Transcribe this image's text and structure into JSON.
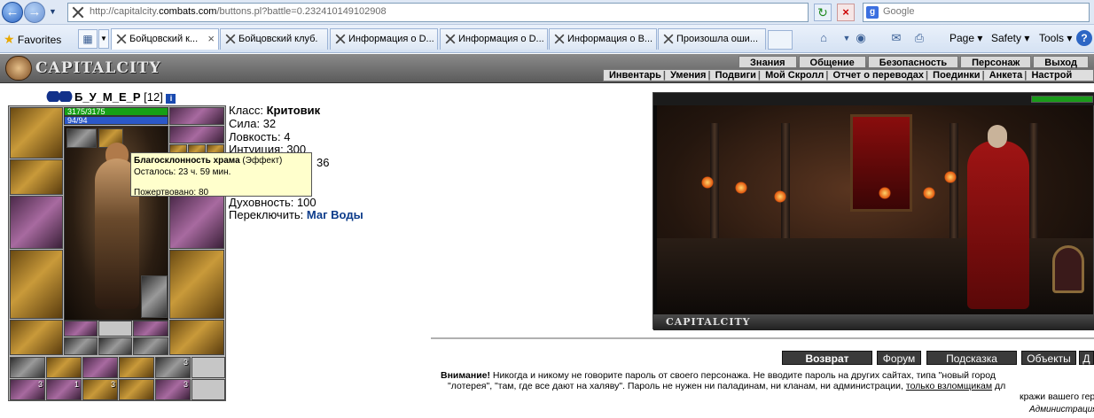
{
  "browser": {
    "url_prefix": "http://capitalcity.",
    "url_domain": "combats.com",
    "url_path": "/buttons.pl?battle=0.232410149102908",
    "search_placeholder": "Google",
    "favorites_label": "Favorites",
    "tabs": [
      {
        "label": "Бойцовский к...",
        "active": true
      },
      {
        "label": "Бойцовский клуб.",
        "active": false
      },
      {
        "label": "Информация о D...",
        "active": false
      },
      {
        "label": "Информация о D...",
        "active": false
      },
      {
        "label": "Информация о В...",
        "active": false
      },
      {
        "label": "Произошла оши...",
        "active": false
      }
    ],
    "commands": {
      "page": "Page",
      "safety": "Safety",
      "tools": "Tools"
    }
  },
  "game": {
    "logo_text": "CAPITALCITY",
    "top_nav": [
      "Знания",
      "Общение",
      "Безопасность",
      "Персонаж",
      "Выход"
    ],
    "sub_nav": [
      "Инвентарь",
      "Умения",
      "Подвиги",
      "Мой Скролл",
      "Отчет о переводах",
      "Поединки",
      "Анкета",
      "Настрой"
    ]
  },
  "character": {
    "name": "Б_У_М_Е_Р",
    "level": "[12]",
    "hp": "3175/3175",
    "mana": "94/94",
    "stats": [
      {
        "label": "Класс:",
        "value": "Критовик",
        "style": "bold"
      },
      {
        "label": "Сила:",
        "value": "32"
      },
      {
        "label": "Ловкость:",
        "value": "4"
      },
      {
        "label": "Интуиция:",
        "value": "300"
      },
      {
        "label": "",
        "value": "36"
      },
      {
        "label": "Духовность:",
        "value": "100"
      },
      {
        "label": "Переключить:",
        "value": "Маг Воды",
        "style": "link"
      }
    ],
    "tooltip": {
      "title": "Благосклонность храма",
      "kind": "(Эффект)",
      "line1": "Осталось: 23 ч. 59 мин.",
      "line2": "Пожертвовано: 80"
    },
    "belt_counts": [
      "3",
      "3",
      "1",
      "3",
      "3"
    ]
  },
  "scene": {
    "brand": "CAPITALCITY"
  },
  "footer": {
    "buttons": [
      "Возврат",
      "Форум",
      "Подсказка",
      "Объекты",
      "Д"
    ],
    "warning_label": "Внимание!",
    "warning_line1": " Никогда и никому не говорите пароль от своего персонажа. Не вводите пароль на других сайтах, типа \"новый город",
    "warning_line2a": "\"лотерея\", \"там, где все дают на халяву\". Пароль не нужен ни паладинам, ни кланам, ни администрации, ",
    "warning_link": "только взломщикам",
    "warning_line2b": " дл",
    "warning_line3": "кражи вашего геро",
    "admin_sign": "Администрация"
  }
}
